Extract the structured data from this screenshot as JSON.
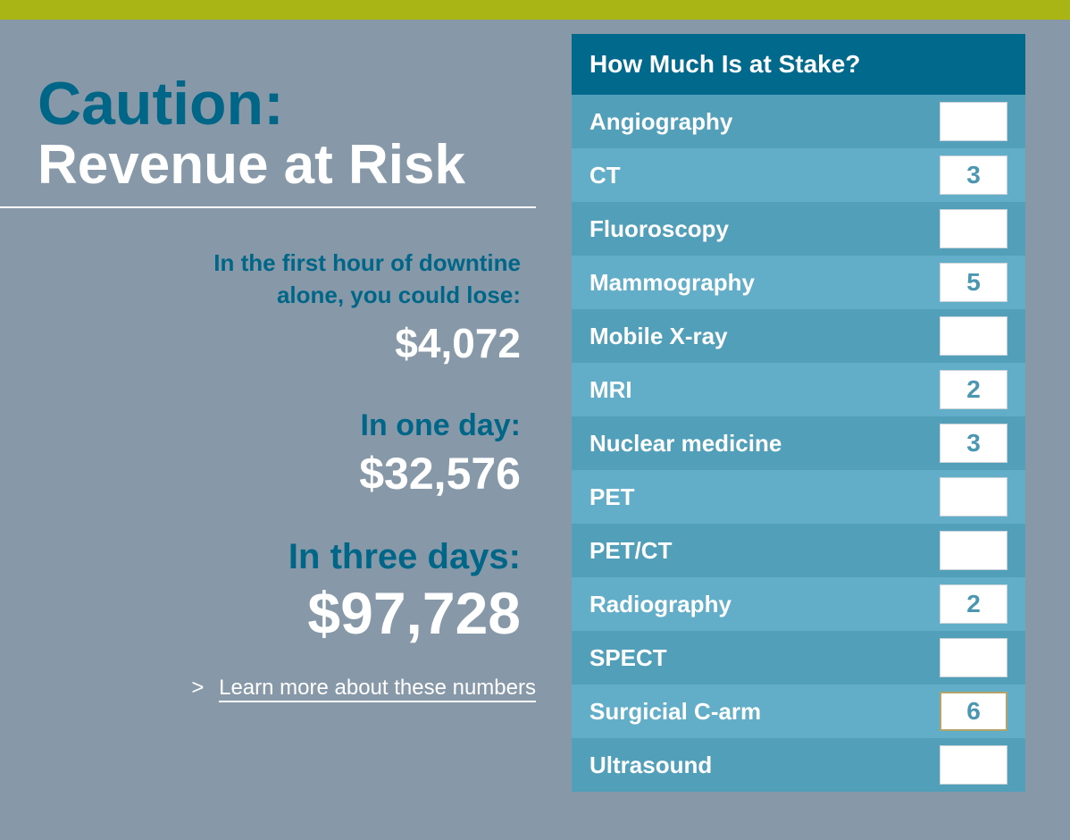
{
  "headline": {
    "line1": "Caution:",
    "line2": "Revenue at Risk"
  },
  "stats": {
    "first_hour_label_line1": "In the first hour of downtine",
    "first_hour_label_line2": "alone, you could lose:",
    "first_hour_value": "$4,072",
    "one_day_label": "In one day:",
    "one_day_value": "$32,576",
    "three_days_label": "In three days:",
    "three_days_value": "$97,728"
  },
  "learn_more": {
    "chevron": ">",
    "label": "Learn more about these numbers"
  },
  "stake_panel": {
    "title": "How Much Is at Stake?",
    "rows": [
      {
        "label": "Angiography",
        "value": ""
      },
      {
        "label": "CT",
        "value": "3"
      },
      {
        "label": "Fluoroscopy",
        "value": ""
      },
      {
        "label": "Mammography",
        "value": "5"
      },
      {
        "label": "Mobile X-ray",
        "value": ""
      },
      {
        "label": "MRI",
        "value": "2"
      },
      {
        "label": "Nuclear medicine",
        "value": "3"
      },
      {
        "label": "PET",
        "value": ""
      },
      {
        "label": "PET/CT",
        "value": ""
      },
      {
        "label": "Radiography",
        "value": "2"
      },
      {
        "label": "SPECT",
        "value": ""
      },
      {
        "label": "Surgicial C-arm",
        "value": "6"
      },
      {
        "label": "Ultrasound",
        "value": ""
      }
    ]
  },
  "colors": {
    "background": "#8799a8",
    "top_bar": "#a9b515",
    "brand_blue": "#006688",
    "panel_header": "#00698c",
    "row_dark": "#529fb9",
    "row_light": "#62aec8"
  }
}
